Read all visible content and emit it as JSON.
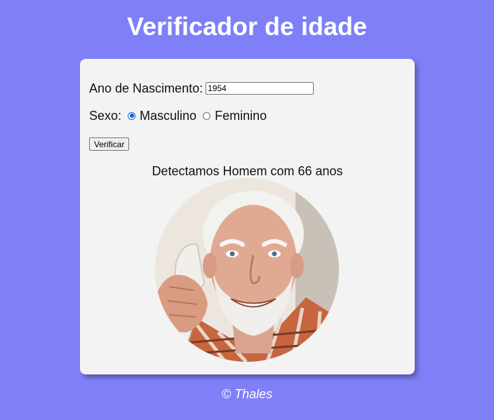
{
  "header": {
    "title": "Verificador de idade"
  },
  "form": {
    "year_label": "Ano de Nascimento:",
    "year_value": "1954",
    "sex_label": "Sexo:",
    "options": [
      {
        "label": "Masculino",
        "checked": true
      },
      {
        "label": "Feminino",
        "checked": false
      }
    ],
    "verify_button": "Verificar"
  },
  "result": {
    "text": "Detectamos Homem com 66 anos",
    "image": "elderly-man-photo"
  },
  "footer": {
    "text": "© Thales"
  },
  "colors": {
    "background": "#7f7ff7",
    "card": "#f3f3f3",
    "radio_accent": "#0b63d6"
  }
}
